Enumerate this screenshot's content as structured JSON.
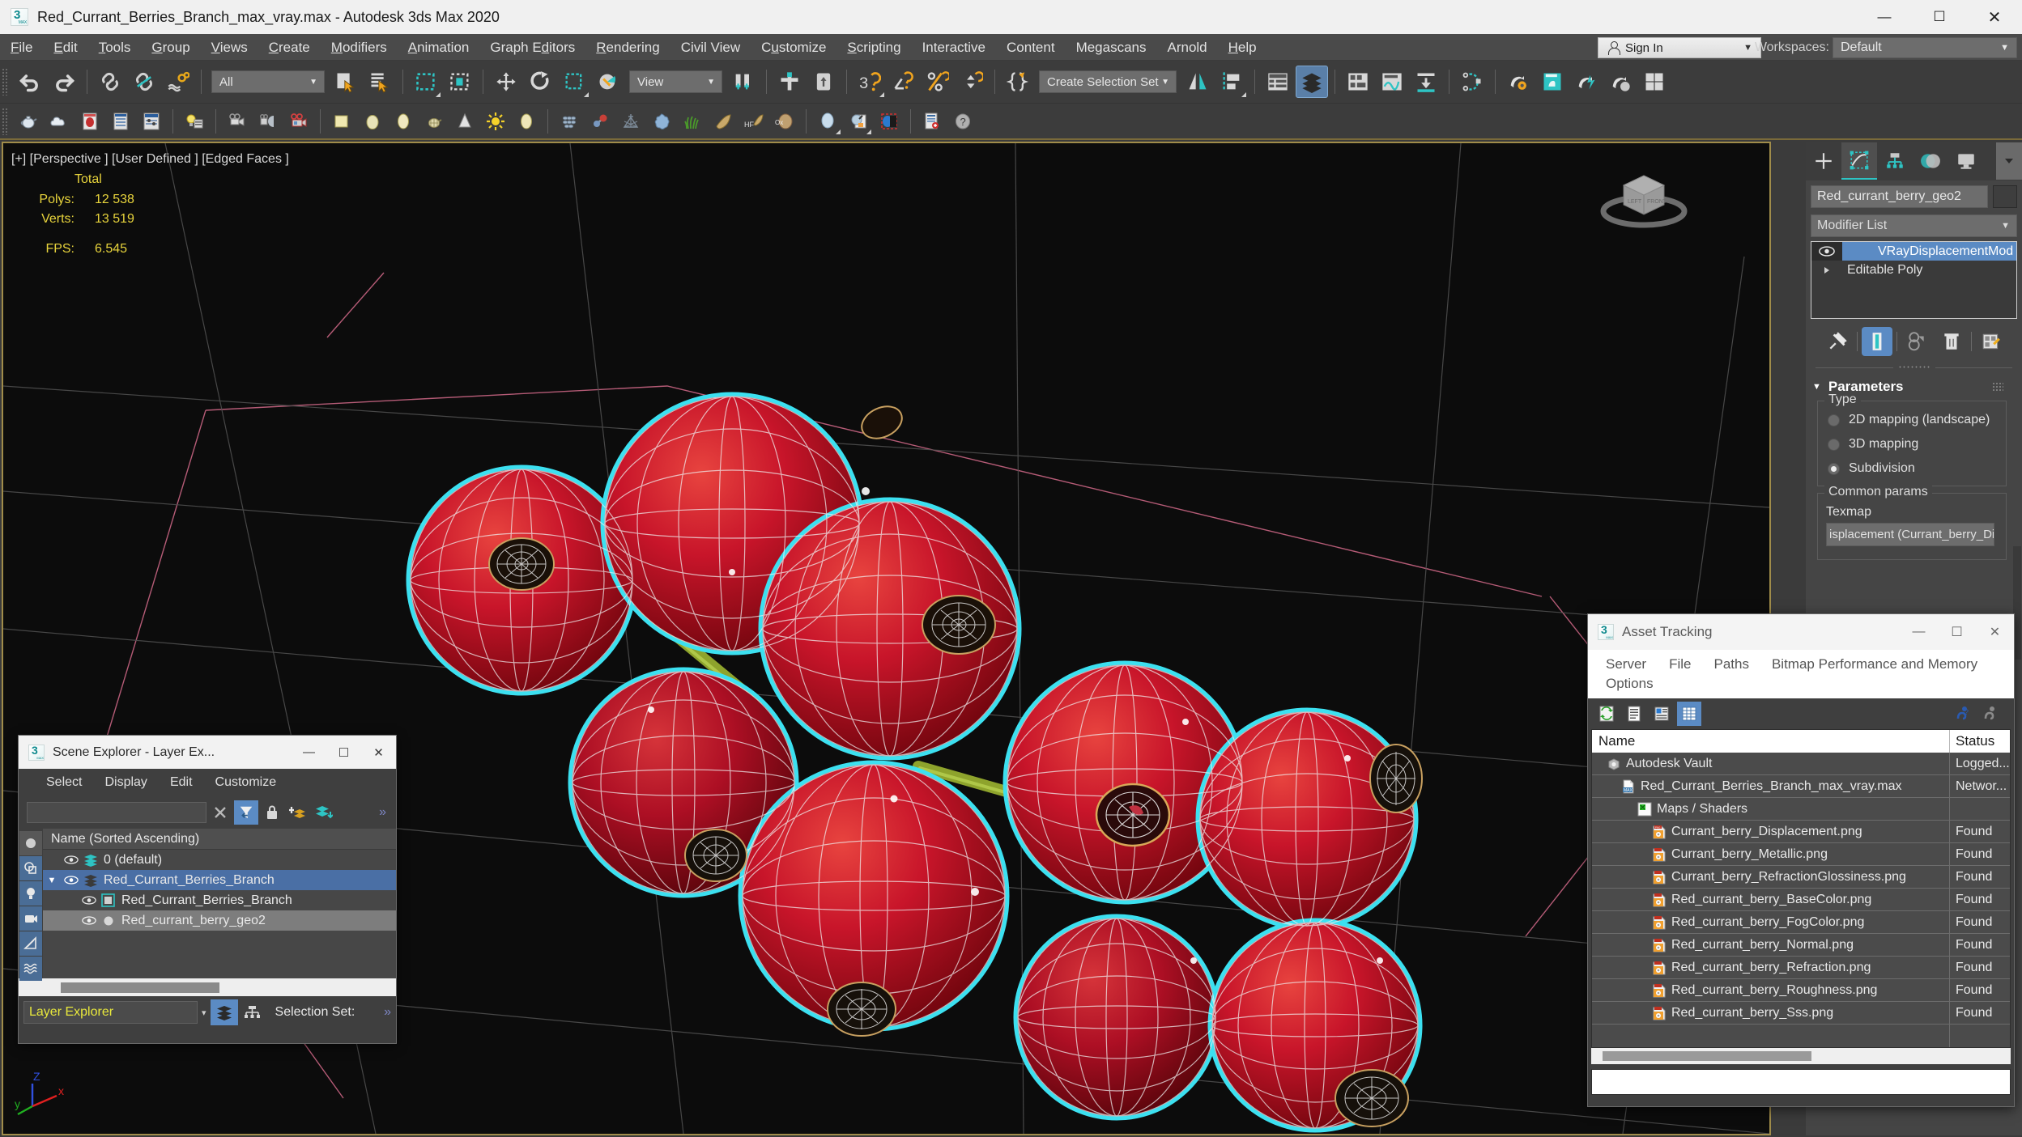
{
  "app": {
    "title": "Red_Currant_Berries_Branch_max_vray.max - Autodesk 3ds Max 2020",
    "window_buttons": {
      "minimize": "—",
      "maximize": "☐",
      "close": "✕"
    }
  },
  "menubar": {
    "items": [
      "File",
      "Edit",
      "Tools",
      "Group",
      "Views",
      "Create",
      "Modifiers",
      "Animation",
      "Graph Editors",
      "Rendering",
      "Civil View",
      "Customize",
      "Scripting",
      "Interactive",
      "Content",
      "Megascans",
      "Arnold",
      "Help"
    ],
    "sign_in": "Sign In",
    "workspaces_label": "Workspaces:",
    "workspace_value": "Default",
    "carat": "▼"
  },
  "toolbar1": {
    "selection_filter": "All",
    "reference_coord": "View",
    "selection_set": "Create Selection Set",
    "carat": "▼",
    "icons": [
      "undo-icon",
      "redo-icon",
      "select-link-icon",
      "unlink-icon",
      "bind-space-warp-icon",
      "select-object-icon",
      "select-by-name-icon",
      "rect-selection-region-icon",
      "window-crossing-icon",
      "select-move-icon",
      "select-rotate-icon",
      "select-scale-icon",
      "placement-icon",
      "use-pivot-center-icon",
      "select-manipulate-icon",
      "snaps-toggle-icon",
      "angle-snap-icon",
      "percent-snap-icon",
      "spinner-snap-icon",
      "named-selection-sets-icon",
      "mirror-icon",
      "align-icon",
      "layer-explorer-icon",
      "scene-explorer-icon",
      "toggle-ribbon-icon",
      "curve-editor-icon",
      "schematic-view-icon",
      "containers-icon",
      "material-editor-icon",
      "render-setup-icon",
      "rendered-frame-window-icon",
      "render-production-icon",
      "render-iterative-icon"
    ]
  },
  "toolbar2": {
    "icons": [
      "teapot-icon",
      "cloud-icon",
      "material-browser-icon",
      "slate-panel-icon",
      "properties-panel-icon",
      "light-setup-icon",
      "camera-icon",
      "physical-camera-icon",
      "vr-camera-icon",
      "box-icon",
      "sphere-icon",
      "oval-icon",
      "teapot-wire-icon",
      "cone-icon",
      "sun-icon",
      "sphere2-icon",
      "grid-mesh-icon",
      "atom-icon",
      "pyramid-wire-icon",
      "blob-icon",
      "grass-icon",
      "feather-icon",
      "hf-icon",
      "ox-icon",
      "balloon-icon",
      "map-browser-icon",
      "proxy-icon",
      "report-icon",
      "help-icon"
    ]
  },
  "viewport": {
    "label": "[+] [Perspective ] [User Defined ] [Edged Faces ]",
    "stats_header": "Total",
    "stats": [
      {
        "key": "Polys:",
        "value": "12 538"
      },
      {
        "key": "Verts:",
        "value": "13 519"
      }
    ],
    "fps_key": "FPS:",
    "fps_value": "6.545",
    "axis": {
      "x": "x",
      "y": "y",
      "z": "Z"
    },
    "colors": {
      "background": "#0c0c0c",
      "border": "#a08c4a",
      "grid": "#5a5a5a",
      "stats_text": "#e8d43c",
      "label_text": "#d8d8d8",
      "berry_red": "#c0192b",
      "selection_highlight": "#3ce0f0",
      "stem_green": "#8fa830",
      "wireframe": "#e6e6e6"
    }
  },
  "command_panel": {
    "tabs": [
      "create-tab",
      "modify-tab",
      "hierarchy-tab",
      "motion-tab",
      "display-tab",
      "utilities-tab"
    ],
    "active_tab_index": 1,
    "object_name": "Red_currant_berry_geo2",
    "modifier_list_label": "Modifier List",
    "carat": "▼",
    "stack": [
      {
        "label": "VRayDisplacementMod",
        "selected": true,
        "has_eye": true
      },
      {
        "label": "Editable Poly",
        "selected": false,
        "has_eye": false
      }
    ],
    "mod_tools": [
      "pin-stack-icon",
      "show-end-result-icon",
      "make-unique-icon",
      "remove-modifier-icon",
      "configure-sets-icon"
    ],
    "rollout": {
      "title": "Parameters",
      "type_group": "Type",
      "type_options": [
        {
          "label": "2D mapping (landscape)",
          "selected": false
        },
        {
          "label": "3D mapping",
          "selected": false
        },
        {
          "label": "Subdivision",
          "selected": true
        }
      ],
      "common_group": "Common params",
      "texmap_label": "Texmap",
      "texmap_value": "isplacement (Currant_berry_Di"
    }
  },
  "scene_explorer": {
    "title": "Scene Explorer - Layer Ex...",
    "window_buttons": {
      "minimize": "—",
      "maximize": "☐",
      "close": "✕"
    },
    "menu": [
      "Select",
      "Display",
      "Edit",
      "Customize"
    ],
    "search_value": "",
    "clear_icon": "✕",
    "icons": [
      "filter-icon",
      "lock-icon",
      "add-layer-icon",
      "layer-stack-icon"
    ],
    "chevron": "»",
    "column_header": "Name (Sorted Ascending)",
    "rows": [
      {
        "name": "0 (default)",
        "indent": 0,
        "state": "normal",
        "icon": "layer-icon",
        "expander": ""
      },
      {
        "name": "Red_Currant_Berries_Branch",
        "indent": 0,
        "state": "selected-blue",
        "icon": "layer-icon",
        "expander": "▼"
      },
      {
        "name": "Red_Currant_Berries_Branch",
        "indent": 1,
        "state": "normal",
        "icon": "group-icon",
        "expander": ""
      },
      {
        "name": "Red_currant_berry_geo2",
        "indent": 1,
        "state": "selected-gray",
        "icon": "object-icon",
        "expander": ""
      }
    ],
    "side_buttons": [
      "all-icon",
      "geometry-icon",
      "light-icon",
      "camera-icon",
      "helper-icon",
      "spacewarp-icon"
    ],
    "footer_field": "Layer Explorer",
    "footer_buttons": [
      "layer-explorer-icon",
      "scene-explorer-icon"
    ],
    "selection_set_label": "Selection Set:"
  },
  "asset_tracking": {
    "title": "Asset Tracking",
    "window_buttons": {
      "minimize": "—",
      "maximize": "☐",
      "close": "✕"
    },
    "menu_line1": [
      "Server",
      "File",
      "Paths",
      "Bitmap Performance and Memory"
    ],
    "menu_line2": [
      "Options"
    ],
    "toolbar_icons": [
      "refresh-icon",
      "list-view-icon",
      "detail-view-icon",
      "table-view-icon"
    ],
    "toolbar_right_icons": [
      "help-blue-icon",
      "help-gray-icon"
    ],
    "columns": [
      "Name",
      "Status"
    ],
    "rows": [
      {
        "name": "Autodesk Vault",
        "status": "Logged...",
        "indent": 0,
        "icon": "vault-icon"
      },
      {
        "name": "Red_Currant_Berries_Branch_max_vray.max",
        "status": "Networ...",
        "indent": 1,
        "icon": "max-file-icon"
      },
      {
        "name": "Maps / Shaders",
        "status": "",
        "indent": 2,
        "icon": "maps-icon"
      },
      {
        "name": "Currant_berry_Displacement.png",
        "status": "Found",
        "indent": 3,
        "icon": "bitmap-icon"
      },
      {
        "name": "Currant_berry_Metallic.png",
        "status": "Found",
        "indent": 3,
        "icon": "bitmap-icon"
      },
      {
        "name": "Currant_berry_RefractionGlossiness.png",
        "status": "Found",
        "indent": 3,
        "icon": "bitmap-icon"
      },
      {
        "name": "Red_currant_berry_BaseColor.png",
        "status": "Found",
        "indent": 3,
        "icon": "bitmap-icon"
      },
      {
        "name": "Red_currant_berry_FogColor.png",
        "status": "Found",
        "indent": 3,
        "icon": "bitmap-icon"
      },
      {
        "name": "Red_currant_berry_Normal.png",
        "status": "Found",
        "indent": 3,
        "icon": "bitmap-icon"
      },
      {
        "name": "Red_currant_berry_Refraction.png",
        "status": "Found",
        "indent": 3,
        "icon": "bitmap-icon"
      },
      {
        "name": "Red_currant_berry_Roughness.png",
        "status": "Found",
        "indent": 3,
        "icon": "bitmap-icon"
      },
      {
        "name": "Red_currant_berry_Sss.png",
        "status": "Found",
        "indent": 3,
        "icon": "bitmap-icon"
      },
      {
        "name": "",
        "status": "",
        "indent": 0,
        "icon": ""
      }
    ]
  }
}
